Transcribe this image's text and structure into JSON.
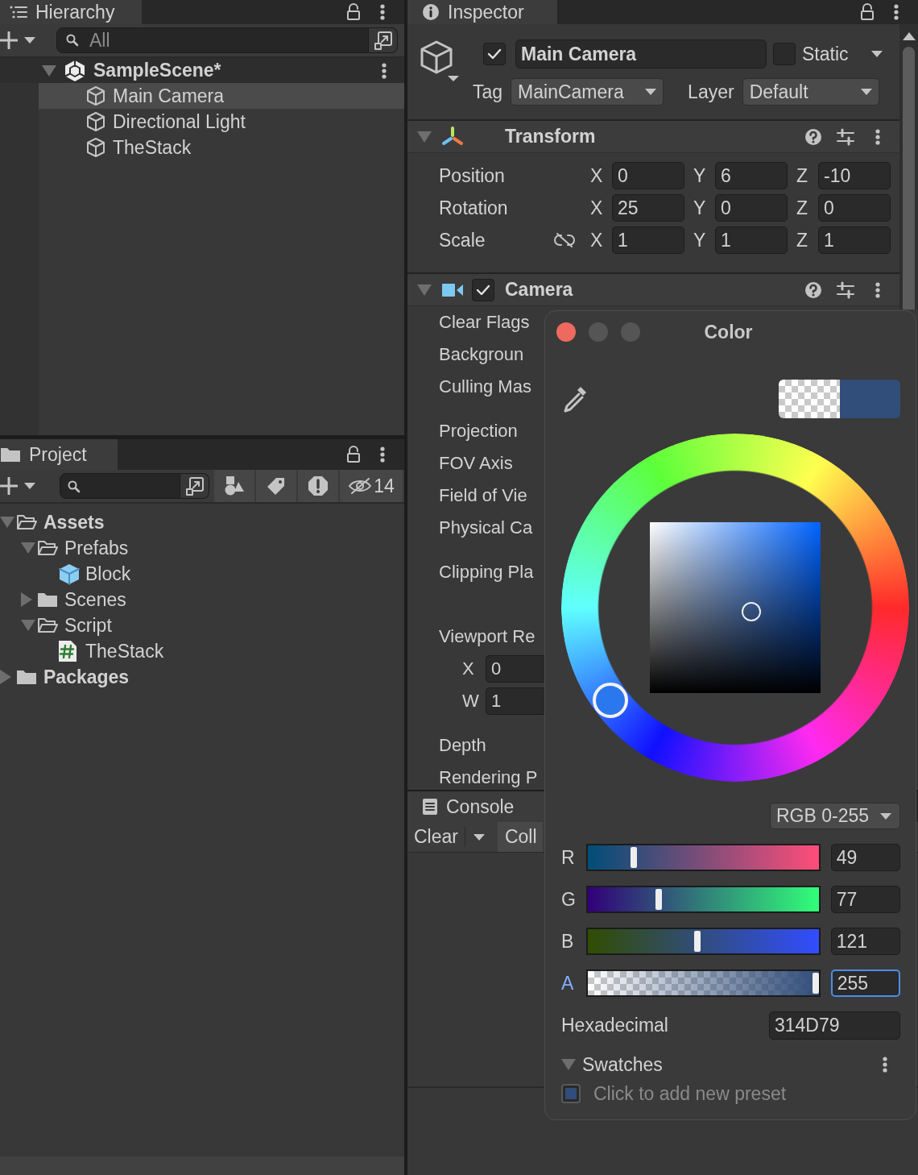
{
  "hierarchy": {
    "tab": {
      "label": "Hierarchy",
      "selected": true
    },
    "search": {
      "placeholder": "All"
    },
    "scene": {
      "name": "SampleScene*",
      "expanded": true
    },
    "items": [
      {
        "name": "Main Camera",
        "selected": true
      },
      {
        "name": "Directional Light",
        "selected": false
      },
      {
        "name": "TheStack",
        "selected": false
      }
    ]
  },
  "project": {
    "tab": {
      "label": "Project",
      "selected": true
    },
    "hidden_count": "14",
    "tree": [
      {
        "name": "Assets",
        "kind": "folder",
        "expanded": true,
        "children": [
          {
            "name": "Prefabs",
            "kind": "folder",
            "expanded": true,
            "children": [
              {
                "name": "Block",
                "kind": "prefab"
              }
            ]
          },
          {
            "name": "Scenes",
            "kind": "folder",
            "expanded": false
          },
          {
            "name": "Script",
            "kind": "folder",
            "expanded": true,
            "children": [
              {
                "name": "TheStack",
                "kind": "script"
              }
            ]
          }
        ]
      },
      {
        "name": "Packages",
        "kind": "folder",
        "expanded": false
      }
    ]
  },
  "inspector": {
    "tab": {
      "label": "Inspector",
      "selected": true
    },
    "object": {
      "active": true,
      "name": "Main Camera",
      "static": false,
      "static_label": "Static",
      "tag_label": "Tag",
      "tag": "MainCamera",
      "layer_label": "Layer",
      "layer": "Default"
    },
    "transform": {
      "title": "Transform",
      "expanded": true,
      "rows": [
        {
          "label": "Position",
          "kind": "vector",
          "fields": [
            {
              "axis": "X",
              "value": "0"
            },
            {
              "axis": "Y",
              "value": "6"
            },
            {
              "axis": "Z",
              "value": "-10"
            }
          ]
        },
        {
          "label": "Rotation",
          "kind": "vector",
          "fields": [
            {
              "axis": "X",
              "value": "25"
            },
            {
              "axis": "Y",
              "value": "0"
            },
            {
              "axis": "Z",
              "value": "0"
            }
          ]
        },
        {
          "label": "Scale",
          "kind": "scale",
          "fields": [
            {
              "axis": "X",
              "value": "1"
            },
            {
              "axis": "Y",
              "value": "1"
            },
            {
              "axis": "Z",
              "value": "1"
            }
          ]
        }
      ]
    },
    "camera": {
      "title": "Camera",
      "expanded": true,
      "enabled": true,
      "properties": [
        {
          "kind": "row",
          "label": "Clear Flags"
        },
        {
          "kind": "row",
          "label": "Backgroun"
        },
        {
          "kind": "row",
          "label": "Culling Mas"
        },
        {
          "kind": "spaced",
          "label": "Projection"
        },
        {
          "kind": "row",
          "label": "FOV Axis"
        },
        {
          "kind": "row",
          "label": "Field of Vie"
        },
        {
          "kind": "row",
          "label": "Physical Ca"
        },
        {
          "kind": "spaced",
          "label": "Clipping Pla"
        },
        {
          "kind": "section",
          "label": "Viewport Re"
        },
        {
          "kind": "field",
          "axis": "X",
          "value": "0"
        },
        {
          "kind": "field",
          "axis": "W",
          "value": "1"
        },
        {
          "kind": "spaced",
          "label": "Depth"
        },
        {
          "kind": "row",
          "label": "Rendering P"
        }
      ]
    }
  },
  "console": {
    "tab": {
      "label": "Console",
      "selected": true
    },
    "buttons": [
      "Clear",
      "Coll"
    ]
  },
  "color_picker": {
    "title": "Color",
    "mode": "RGB 0-255",
    "channels": [
      {
        "kind": "red",
        "name": "R",
        "level": 0.192,
        "value": "49",
        "focused": false
      },
      {
        "kind": "green",
        "name": "G",
        "level": 0.302,
        "value": "77",
        "focused": false
      },
      {
        "kind": "blue",
        "name": "B",
        "level": 0.475,
        "value": "121",
        "focused": false
      },
      {
        "kind": "alpha",
        "name": "A",
        "level": 1,
        "value": "255",
        "focused": true
      }
    ],
    "hex_label": "Hexadecimal",
    "hex": "314D79",
    "swatches": {
      "title": "Swatches",
      "expanded": true,
      "hint": "Click to add new preset"
    }
  }
}
